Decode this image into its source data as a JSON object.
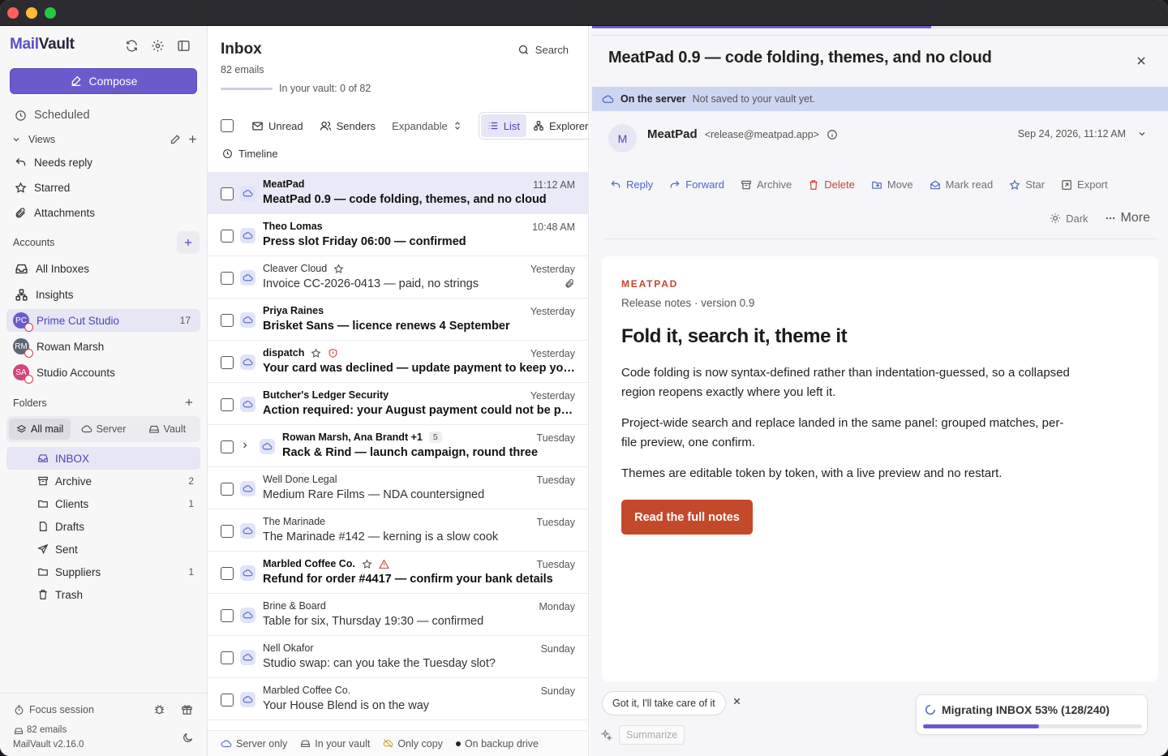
{
  "app": {
    "name_prefix": "Mail",
    "name_suffix": "Vault"
  },
  "sidebar": {
    "compose_label": "Compose",
    "scheduled_label": "Scheduled",
    "views_label": "Views",
    "views": [
      {
        "label": "Needs reply",
        "icon": "reply-icon"
      },
      {
        "label": "Starred",
        "icon": "star-icon"
      },
      {
        "label": "Attachments",
        "icon": "paperclip-icon"
      }
    ],
    "accounts_label": "Accounts",
    "accounts": [
      {
        "label": "All Inboxes",
        "icon": "inbox-icon"
      },
      {
        "label": "Insights",
        "icon": "insights-icon"
      },
      {
        "label": "Prime Cut Studio",
        "initials": "PC",
        "color": "#6a5bcd",
        "count": "17"
      },
      {
        "label": "Rowan Marsh",
        "initials": "RM",
        "color": "#5c6675"
      },
      {
        "label": "Studio Accounts",
        "initials": "SA",
        "color": "#d6457c"
      }
    ],
    "folders_label": "Folders",
    "folder_filters": [
      "All mail",
      "Server",
      "Vault"
    ],
    "folders": [
      {
        "label": "INBOX",
        "icon": "inbox-icon",
        "count": ""
      },
      {
        "label": "Archive",
        "icon": "archive-icon",
        "count": "2"
      },
      {
        "label": "Clients",
        "icon": "folder-icon",
        "count": "1"
      },
      {
        "label": "Drafts",
        "icon": "draft-icon",
        "count": ""
      },
      {
        "label": "Sent",
        "icon": "sent-icon",
        "count": ""
      },
      {
        "label": "Suppliers",
        "icon": "folder-icon",
        "count": "1"
      },
      {
        "label": "Trash",
        "icon": "trash-icon",
        "count": ""
      }
    ],
    "footer": {
      "focus": "Focus session",
      "emails": "82 emails",
      "version": "MailVault v2.16.0"
    }
  },
  "list": {
    "title": "Inbox",
    "count": "82 emails",
    "vault_status": "In your vault: 0 of 82",
    "search_label": "Search",
    "toolbar": {
      "unread": "Unread",
      "senders": "Senders",
      "expandable": "Expandable",
      "list": "List",
      "explorer": "Explorer"
    },
    "timeline_label": "Timeline",
    "emails": [
      {
        "from": "MeatPad",
        "subject": "MeatPad 0.9 — code folding, themes, and no cloud",
        "time": "11:12 AM",
        "bold": true,
        "selected": true
      },
      {
        "from": "Theo Lomas",
        "subject": "Press slot Friday 06:00 — confirmed",
        "time": "10:48 AM",
        "bold": true
      },
      {
        "from": "Cleaver Cloud",
        "subject": "Invoice CC-2026-0413 — paid, no strings",
        "time": "Yesterday",
        "bold": false,
        "star": true,
        "attachment": true
      },
      {
        "from": "Priya Raines",
        "subject": "Brisket Sans — licence renews 4 September",
        "time": "Yesterday",
        "bold": true
      },
      {
        "from": "dispatch",
        "subject": "Your card was declined — update payment to keep your o...",
        "time": "Yesterday",
        "bold": true,
        "star": true,
        "shield": true
      },
      {
        "from": "Butcher's Ledger Security",
        "subject": "Action required: your August payment could not be proc...",
        "time": "Yesterday",
        "bold": true
      },
      {
        "from": "Rowan Marsh, Ana Brandt +1",
        "subject": "Rack & Rind — launch campaign, round three",
        "time": "Tuesday",
        "bold": true,
        "thread": "5"
      },
      {
        "from": "Well Done Legal",
        "subject": "Medium Rare Films — NDA countersigned",
        "time": "Tuesday",
        "bold": false
      },
      {
        "from": "The Marinade",
        "subject": "The Marinade #142 — kerning is a slow cook",
        "time": "Tuesday",
        "bold": false
      },
      {
        "from": "Marbled Coffee Co.",
        "subject": "Refund for order #4417 — confirm your bank details",
        "time": "Tuesday",
        "bold": true,
        "star": true,
        "warning": true
      },
      {
        "from": "Brine & Board",
        "subject": "Table for six, Thursday 19:30 — confirmed",
        "time": "Monday",
        "bold": false
      },
      {
        "from": "Nell Okafor",
        "subject": "Studio swap: can you take the Tuesday slot?",
        "time": "Sunday",
        "bold": false
      },
      {
        "from": "Marbled Coffee Co.",
        "subject": "Your House Blend is on the way",
        "time": "Sunday",
        "bold": false
      }
    ],
    "footer_legend": [
      "Server only",
      "In your vault",
      "Only copy",
      "On backup drive"
    ]
  },
  "reader": {
    "title": "MeatPad 0.9 — code folding, themes, and no cloud",
    "server_label": "On the server",
    "server_note": "Not saved to your vault yet.",
    "sender_initial": "M",
    "sender_name": "MeatPad",
    "sender_email": "<release@meatpad.app>",
    "date": "Sep 24, 2026, 11:12 AM",
    "actions": [
      "Reply",
      "Forward",
      "Archive",
      "Delete",
      "Move",
      "Mark read",
      "Star",
      "Export"
    ],
    "dark_label": "Dark",
    "more_label": "More",
    "body": {
      "brand": "MEATPAD",
      "version": "Release notes · version 0.9",
      "heading": "Fold it, search it, theme it",
      "paragraphs": [
        "Code folding is now syntax-defined rather than indentation-guessed, so a collapsed region reopens exactly where you left it.",
        "Project-wide search and replace landed in the same panel: grouped matches, per-file preview, one confirm.",
        "Themes are editable token by token, with a live preview and no restart."
      ],
      "cta": "Read the full notes"
    },
    "quick_reply": "Got it, I'll take care of it",
    "summarize_label": "Summarize",
    "migration": {
      "label": "Migrating INBOX 53% (128/240)",
      "progress": 0.53
    }
  },
  "colors": {
    "accent": "#6a5bcd",
    "cta": "#c4492b",
    "brand_text": "#c8452a",
    "server_banner": "#cdd6f0"
  }
}
